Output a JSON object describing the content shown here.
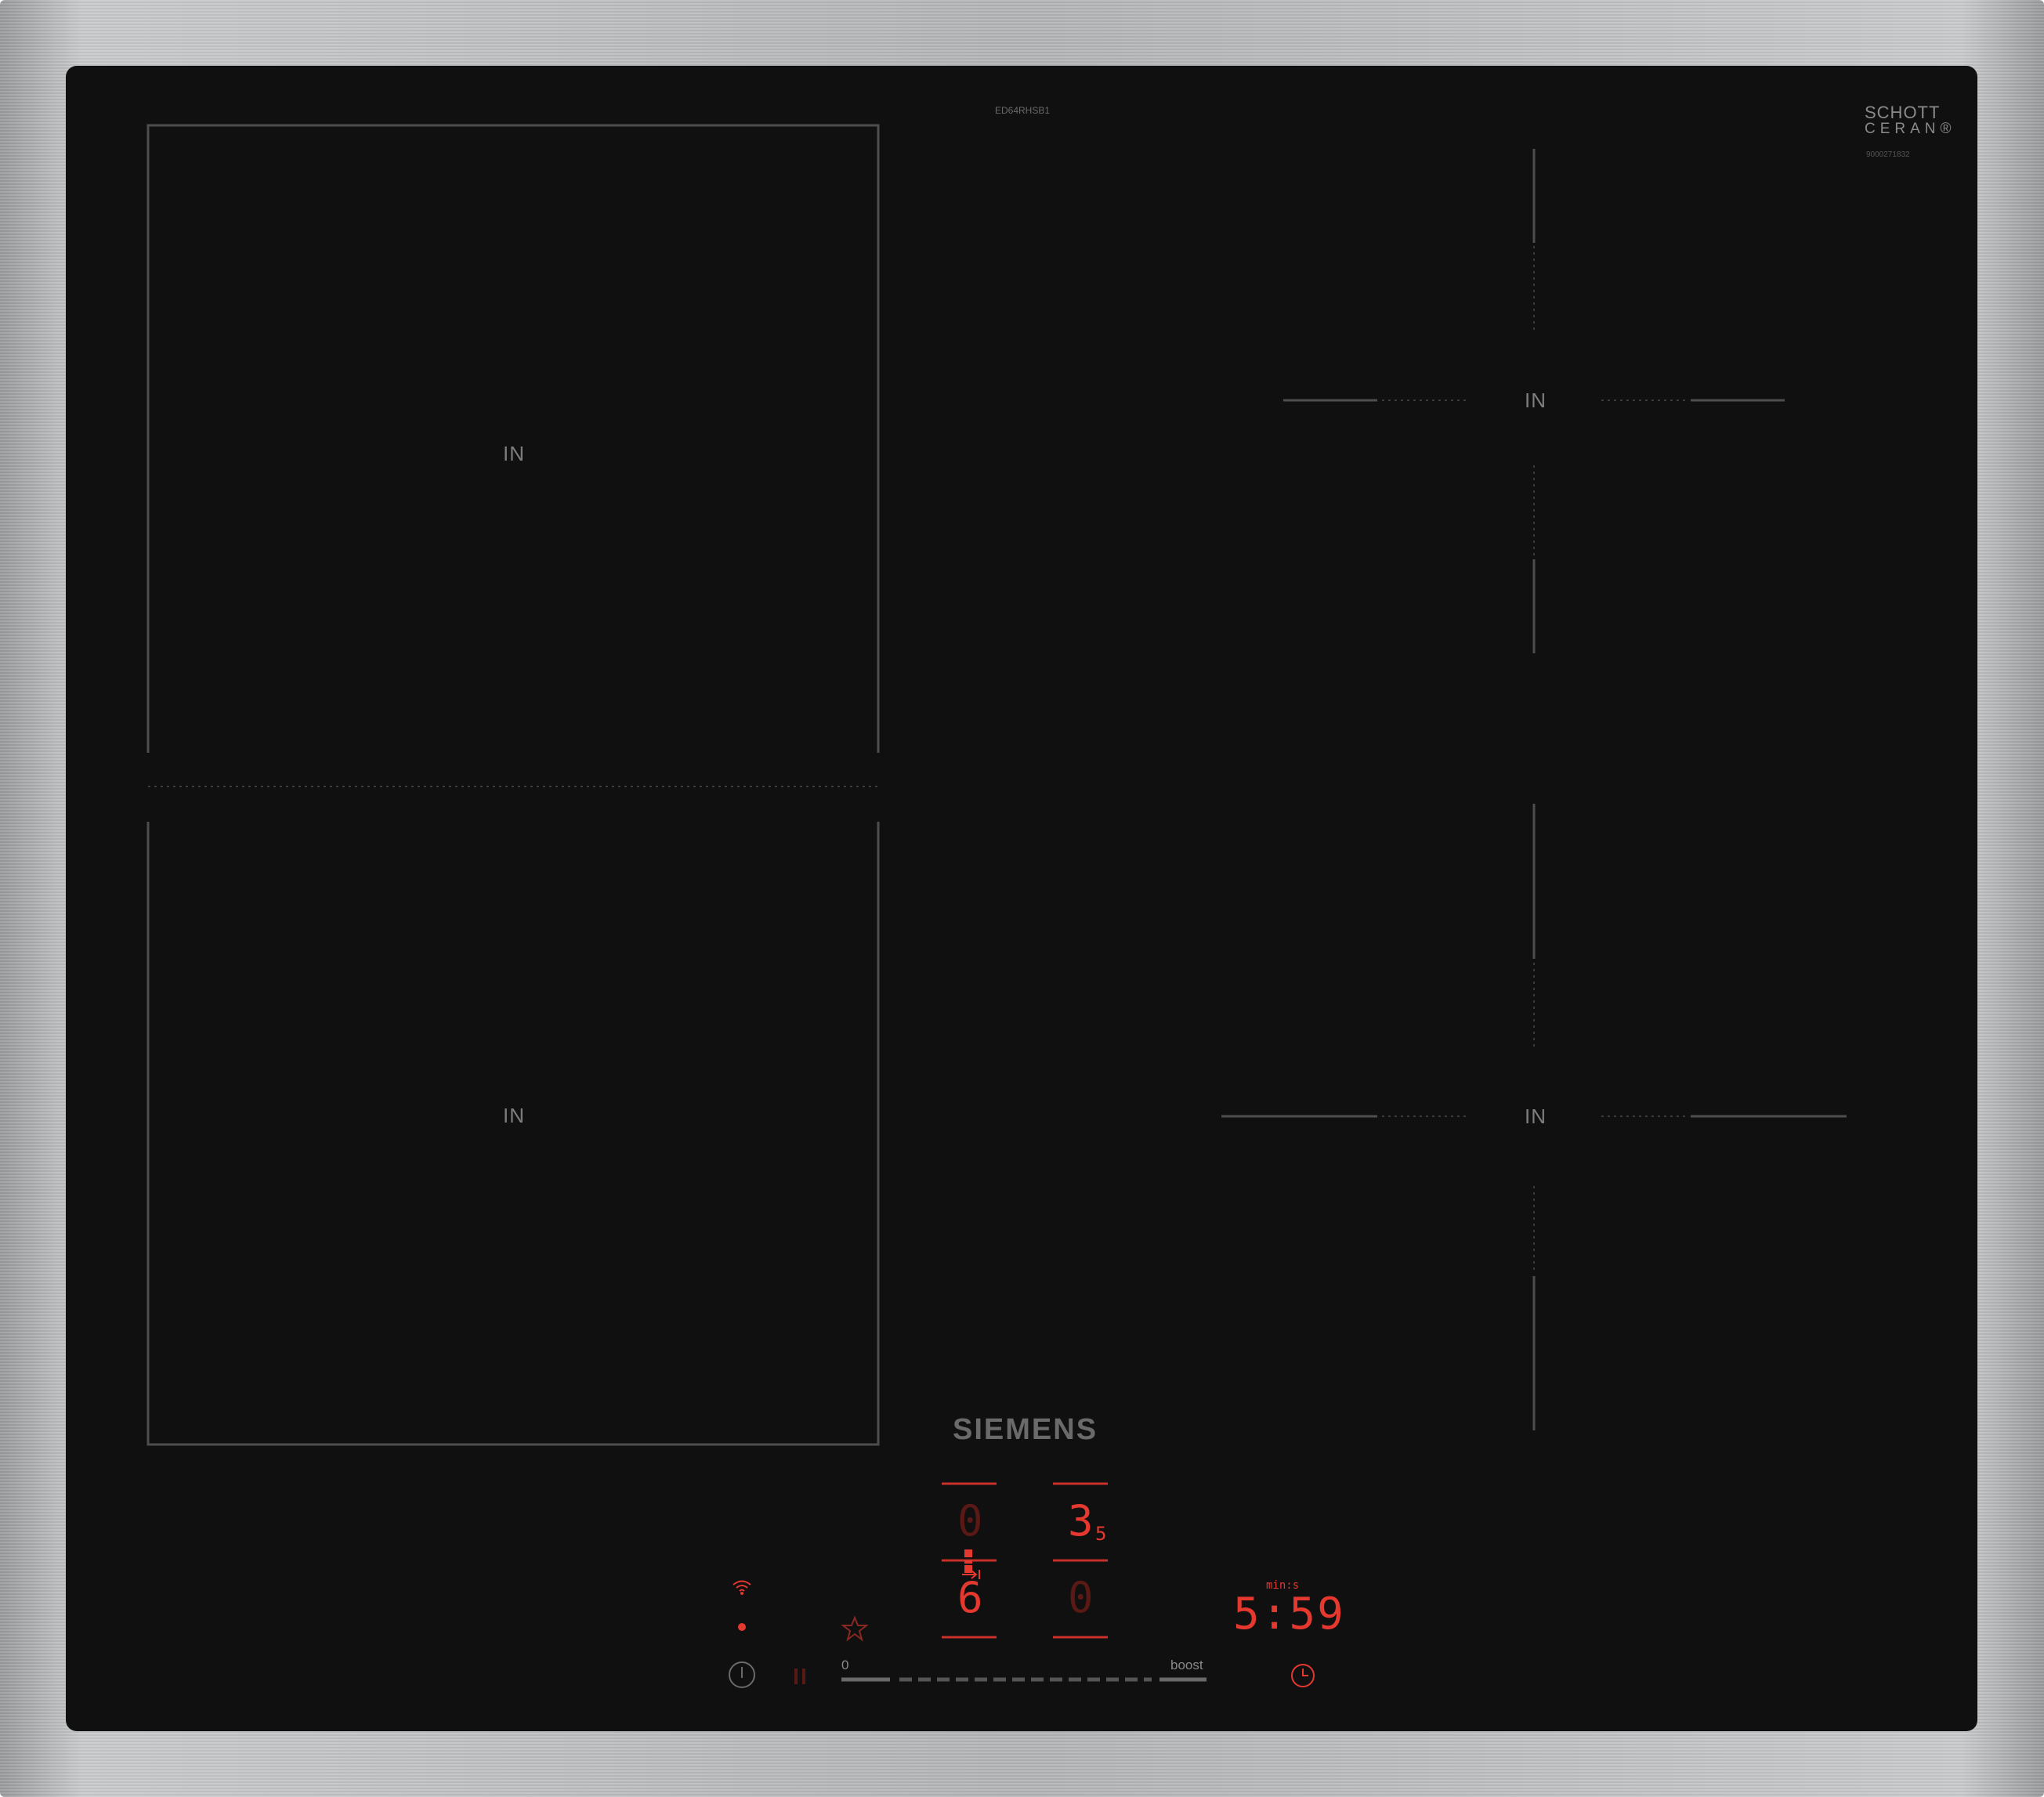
{
  "model_code": "ED64RHSB1",
  "schott_line1": "SCHOTT",
  "schott_line2": "CERAN®",
  "schott_code": "9000271832",
  "brand": "SIEMENS",
  "zones": {
    "left_top": "IN",
    "left_bottom": "IN",
    "right_top": "IN",
    "right_bottom": "IN"
  },
  "display": {
    "zone_front_left": "0",
    "zone_front_right": "3",
    "zone_front_right_sub": "5",
    "zone_rear_left": "6",
    "zone_rear_right": "0",
    "timer_unit": "min:s",
    "timer": "5:59"
  },
  "slider": {
    "min_label": "0",
    "max_label": "boost"
  },
  "icons": {
    "power": "power-icon",
    "pause": "pause-icon",
    "favorite": "star-icon",
    "wifi": "wifi-icon",
    "timer": "clock-icon",
    "zone_link": "zone-link-icon",
    "move": "move-arrow-icon"
  },
  "colors": {
    "glass": "#101010",
    "display_red": "#e5382f",
    "print_grey": "#7e7e7e",
    "frame_steel": "#b3b5b7"
  }
}
